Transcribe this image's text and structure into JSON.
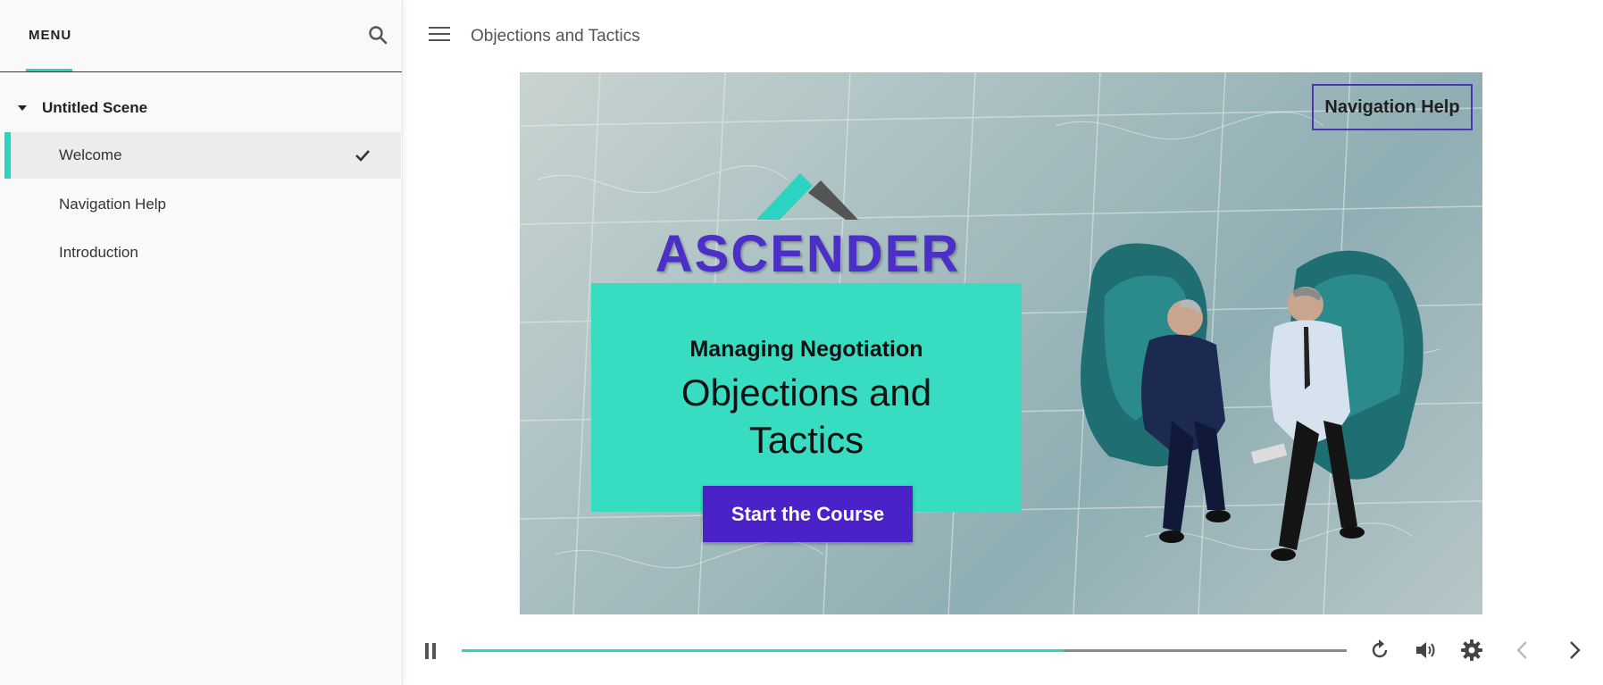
{
  "sidebar": {
    "menu_label": "MENU",
    "search_icon": "search-icon",
    "scene": {
      "label": "Untitled Scene",
      "expanded": true
    },
    "items": [
      {
        "label": "Welcome",
        "active": true,
        "completed": true
      },
      {
        "label": "Navigation Help",
        "active": false,
        "completed": false
      },
      {
        "label": "Introduction",
        "active": false,
        "completed": false
      }
    ]
  },
  "header": {
    "title": "Objections and Tactics",
    "menu_icon": "hamburger-icon"
  },
  "slide": {
    "nav_help_label": "Navigation Help",
    "logo_text": "ASCENDER",
    "subtitle": "Managing Negotiation",
    "title_line1": "Objections and",
    "title_line2": "Tactics",
    "start_button_label": "Start the Course"
  },
  "player": {
    "progress": 0.68,
    "icons": [
      "pause-icon",
      "replay-icon",
      "volume-icon",
      "settings-icon",
      "prev-icon",
      "next-icon"
    ]
  },
  "colors": {
    "accent": "#2ad4c0",
    "brand_purple": "#4a22c8",
    "title_box": "#38dcc1"
  }
}
